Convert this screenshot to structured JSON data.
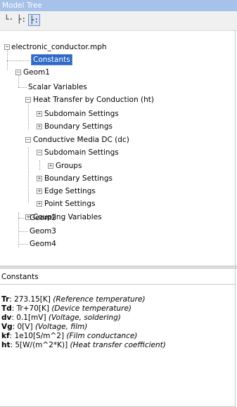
{
  "title": "Model Tree",
  "toolbar": {
    "buttons": [
      {
        "glyph": "└·"
      },
      {
        "glyph": "├:"
      },
      {
        "glyph": "├:"
      }
    ]
  },
  "tree": {
    "root": "electronic_conductor.mph",
    "constants": "Constants",
    "geom1": "Geom1",
    "scalar_variables": "Scalar Variables",
    "ht": "Heat Transfer by Conduction (ht)",
    "ht_subdomain": "Subdomain Settings",
    "ht_boundary": "Boundary Settings",
    "dc": "Conductive Media DC (dc)",
    "dc_subdomain": "Subdomain Settings",
    "dc_groups": "Groups",
    "dc_boundary": "Boundary Settings",
    "dc_edge": "Edge Settings",
    "dc_point": "Point Settings",
    "coupling": "Coupling Variables",
    "geom2": "Geom2",
    "geom3": "Geom3",
    "geom4": "Geom4"
  },
  "panel": {
    "title": "Constants",
    "constants": [
      {
        "name": "Tr",
        "value": ": 273.15[K] ",
        "desc": "(Reference temperature)"
      },
      {
        "name": "Td",
        "value": ": Tr+70[K] ",
        "desc": "(Device temperature)"
      },
      {
        "name": "dv",
        "value": ": 0.1[mV] ",
        "desc": "(Voltage, soldering)"
      },
      {
        "name": "Vg",
        "value": ": 0[V] ",
        "desc": "(Voltage, film)"
      },
      {
        "name": "kf",
        "value": ": 1e10[S/m^2] ",
        "desc": "(Film conductance)"
      },
      {
        "name": "ht",
        "value": ": 5[W/(m^2*K)] ",
        "desc": "(Heat transfer coefficient)"
      }
    ]
  }
}
